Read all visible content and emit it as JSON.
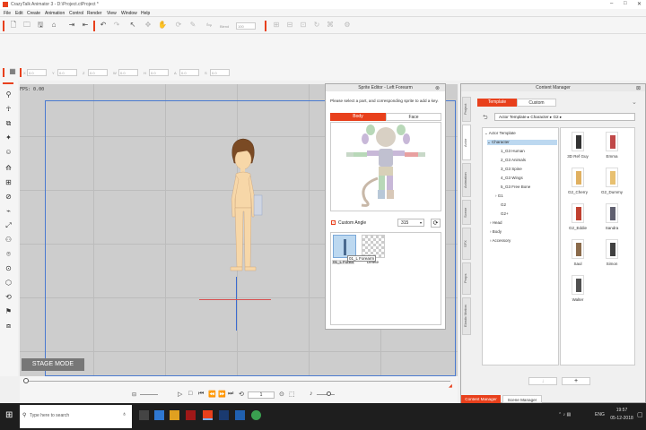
{
  "app": {
    "title": "CrazyTalk Animator 3 - D:\\Project.ctProject *"
  },
  "menu": [
    "File",
    "Edit",
    "Create",
    "Animation",
    "Control",
    "Render",
    "View",
    "Window",
    "Help"
  ],
  "toolbar": {
    "blend_label": "Blend",
    "blend_value": "100",
    "fields": [
      {
        "label": "X",
        "value": "0.0"
      },
      {
        "label": "Y",
        "value": "0.0"
      },
      {
        "label": "Z",
        "value": "0.0"
      },
      {
        "label": "W",
        "value": "0.0"
      },
      {
        "label": "H",
        "value": "0.0"
      },
      {
        "label": "A",
        "value": "0.0"
      },
      {
        "label": "S",
        "value": "0.0"
      }
    ]
  },
  "stage": {
    "fps": "FPS: 0.00",
    "mode_label": "STAGE MODE"
  },
  "timeline": {
    "frame": "1"
  },
  "sprite_editor": {
    "title": "Sprite Editor - Left Forearm",
    "instruction": "Please select a part, and corresponding sprite to add a key.",
    "tabs": [
      "Body",
      "Face"
    ],
    "active_tab": "Body",
    "custom_angle_label": "Custom Angle",
    "custom_angle_checked": true,
    "angle_value": "315",
    "sprites": [
      {
        "name": "01_L Forea",
        "tooltip": "01_L Forearm"
      },
      {
        "name": "Delete"
      }
    ]
  },
  "content_manager": {
    "title": "Content Manager",
    "tabs": [
      "Template",
      "Custom"
    ],
    "active_tab": "Template",
    "breadcrumb": [
      "Actor Template",
      "Character",
      "G2"
    ],
    "side_tabs": [
      "Project",
      "Actor",
      "Animation",
      "Scene",
      "SFX",
      "Props",
      "Elastic Motion"
    ],
    "tree": [
      {
        "label": "Actor Template",
        "level": 0,
        "state": "expanded"
      },
      {
        "label": "Character",
        "level": 1,
        "state": "expanded",
        "selected": true
      },
      {
        "label": "1_G3 Human",
        "level": 2
      },
      {
        "label": "2_G3 Animals",
        "level": 2
      },
      {
        "label": "3_G3 Spine",
        "level": 2
      },
      {
        "label": "4_G3 Wings",
        "level": 2
      },
      {
        "label": "5_G3 Free Bone",
        "level": 2
      },
      {
        "label": "G1",
        "level": 2,
        "state": "collapsed"
      },
      {
        "label": "G2",
        "level": 2
      },
      {
        "label": "G2+",
        "level": 2
      },
      {
        "label": "Head",
        "level": 1,
        "state": "collapsed"
      },
      {
        "label": "Body",
        "level": 1,
        "state": "collapsed"
      },
      {
        "label": "Accessory",
        "level": 1,
        "state": "collapsed"
      }
    ],
    "thumbnails": [
      "3D Ref Guy",
      "Emma",
      "G2_Cherry",
      "G2_Dummy",
      "G2_Eddie",
      "Sandra",
      "Saul",
      "Simon",
      "Walter"
    ],
    "bottom_tabs": [
      "Content Manager",
      "Scene Manager"
    ],
    "active_bottom_tab": "Content Manager"
  },
  "taskbar": {
    "search_placeholder": "Type here to search",
    "time": "19:57",
    "date": "05-12-2018",
    "lang": "ENG"
  },
  "colors": {
    "accent": "#e8401c",
    "stage_bg": "#cdcdcd",
    "frame_border": "#4a7ad0"
  }
}
